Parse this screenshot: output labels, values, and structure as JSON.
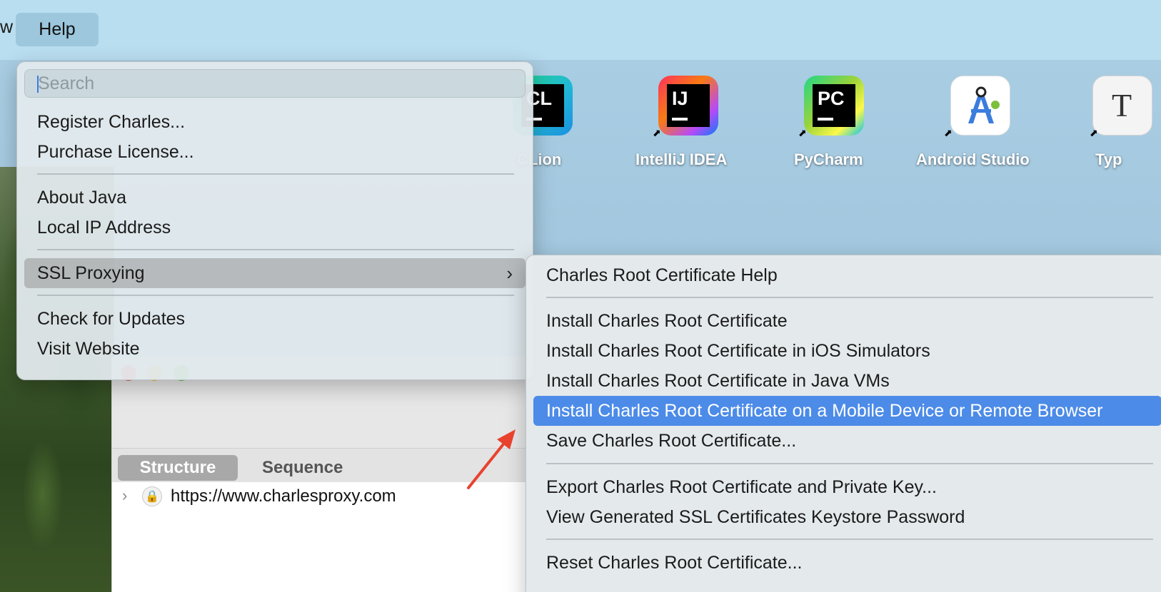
{
  "menubar": {
    "prev_menu_fragment": "w",
    "help_label": "Help"
  },
  "desktop": {
    "apps": [
      {
        "label": "CLion",
        "glyph": "CL",
        "icon": "clion-icon"
      },
      {
        "label": "IntelliJ IDEA",
        "glyph": "IJ",
        "icon": "intellij-idea-icon"
      },
      {
        "label": "PyCharm",
        "glyph": "PC",
        "icon": "pycharm-icon"
      },
      {
        "label": "Android Studio",
        "glyph": "A",
        "icon": "android-studio-icon"
      },
      {
        "label": "Typ",
        "glyph": "T",
        "icon": "typora-icon"
      }
    ]
  },
  "help_menu": {
    "search_placeholder": "Search",
    "items": [
      {
        "label": "Register Charles..."
      },
      {
        "label": "Purchase License..."
      },
      {
        "label": "About Java"
      },
      {
        "label": "Local IP Address"
      },
      {
        "label": "SSL Proxying",
        "has_submenu": true,
        "active": true
      },
      {
        "label": "Check for Updates"
      },
      {
        "label": "Visit Website"
      }
    ]
  },
  "ssl_submenu": {
    "items": [
      {
        "label": "Charles Root Certificate Help"
      },
      {
        "label": "Install Charles Root Certificate"
      },
      {
        "label": "Install Charles Root Certificate in iOS Simulators"
      },
      {
        "label": "Install Charles Root Certificate in Java VMs"
      },
      {
        "label": "Install Charles Root Certificate on a Mobile Device or Remote Browser",
        "highlighted": true
      },
      {
        "label": "Save Charles Root Certificate..."
      },
      {
        "label": "Export Charles Root Certificate and Private Key..."
      },
      {
        "label": "View Generated SSL Certificates Keystore Password"
      },
      {
        "label": "Reset Charles Root Certificate..."
      }
    ]
  },
  "charles_window": {
    "tabs": [
      {
        "label": "Structure",
        "selected": true
      },
      {
        "label": "Sequence",
        "selected": false
      }
    ],
    "tree": [
      {
        "host": "https://www.charlesproxy.com",
        "secure": true
      }
    ]
  },
  "colors": {
    "highlight": "#4c8be8",
    "annotation_arrow": "#e8422f"
  }
}
